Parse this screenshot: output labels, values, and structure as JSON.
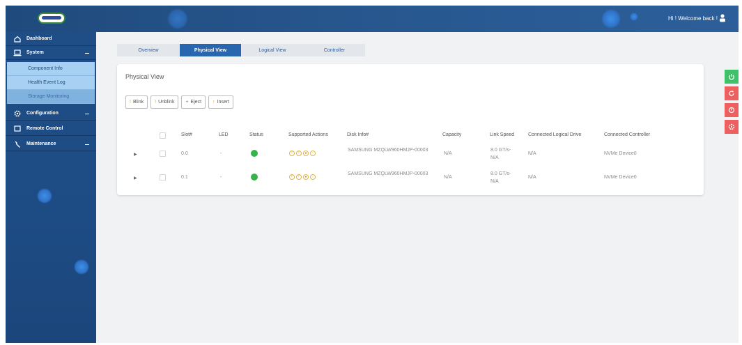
{
  "header": {
    "welcome": "Hi ! Welcome back !"
  },
  "sidebar": {
    "items": [
      {
        "label": "Dashboard",
        "icon": "home-icon"
      },
      {
        "label": "System",
        "icon": "laptop-icon",
        "expanded": true
      },
      {
        "label": "Component Info"
      },
      {
        "label": "Health Event Log"
      },
      {
        "label": "Storage Monitoring",
        "active": true
      },
      {
        "label": "Configuration",
        "icon": "gear-icon"
      },
      {
        "label": "Remote Control",
        "icon": "monitor-icon"
      },
      {
        "label": "Maintenance",
        "icon": "wrench-icon"
      }
    ]
  },
  "tabs": [
    {
      "label": "Overview"
    },
    {
      "label": "Physical View",
      "active": true
    },
    {
      "label": "Logical View"
    },
    {
      "label": "Controller"
    }
  ],
  "panel": {
    "title": "Physical View",
    "buttons": [
      "Blink",
      "Unblink",
      "Eject",
      "Insert"
    ]
  },
  "table": {
    "headers": {
      "slot": "Slot#",
      "led": "LED",
      "status": "Status",
      "actions": "Supported Actions",
      "disk": "Disk Info#",
      "capacity": "Capacity",
      "speed": "Link Speed",
      "logical": "Connected Logical Drive",
      "controller": "Connected Controller"
    },
    "rows": [
      {
        "slot": "0.0",
        "led": "-",
        "disk": "SAMSUNG MZQLW960HMJP-00003",
        "capacity": "N/A",
        "speed": "8.0 GT/s-N/A",
        "logical": "N/A",
        "controller": "NVMe Device0"
      },
      {
        "slot": "0.1",
        "led": "-",
        "disk": "SAMSUNG MZQLW960HMJP-00003",
        "capacity": "N/A",
        "speed": "8.0 GT/s-N/A",
        "logical": "N/A",
        "controller": "NVMe Device0"
      }
    ]
  },
  "colors": {
    "topbar": "#27568d",
    "sidebar": "#1f4d86",
    "active_tab": "#2866b0",
    "status_ok": "#36b34a",
    "power_button": "#3fc16a",
    "control_red": "#ee5f5f"
  }
}
